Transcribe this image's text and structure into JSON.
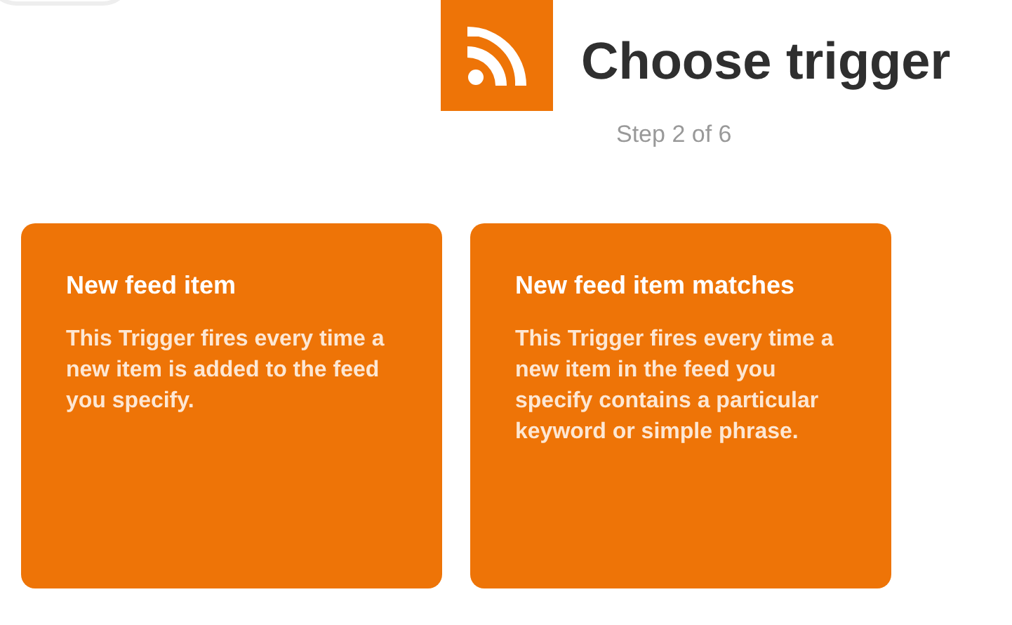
{
  "header": {
    "title": "Choose trigger",
    "step": "Step 2 of 6"
  },
  "triggers": [
    {
      "title": "New feed item",
      "description": "This Trigger fires every time a new item is added to the feed you specify."
    },
    {
      "title": "New feed item matches",
      "description": "This Trigger fires every time a new item in the feed you specify contains a particular keyword or simple phrase."
    }
  ]
}
